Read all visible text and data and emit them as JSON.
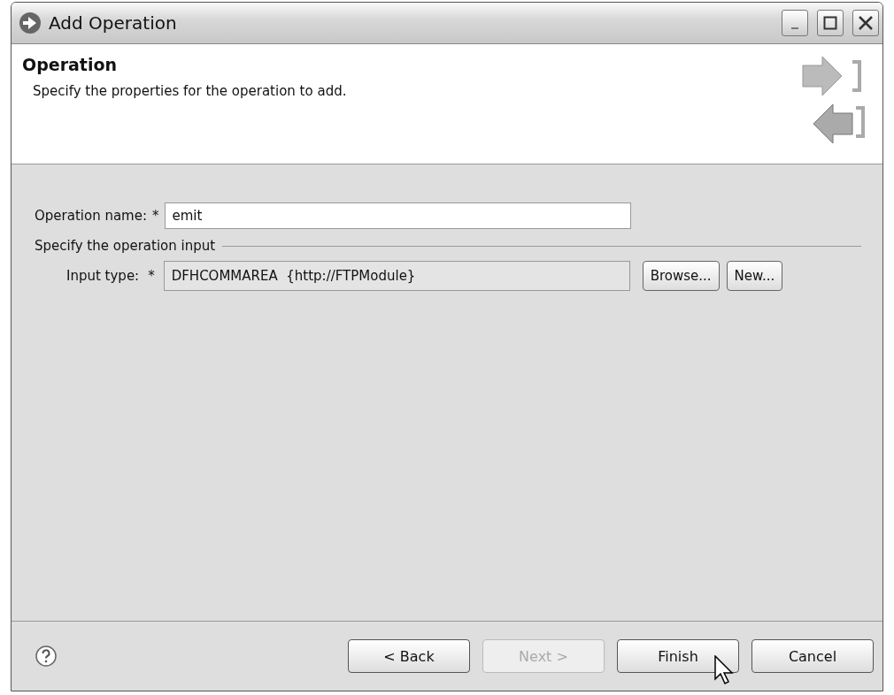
{
  "window": {
    "title": "Add Operation"
  },
  "header": {
    "title": "Operation",
    "description": "Specify the properties for the operation to add."
  },
  "form": {
    "name_label": "Operation name:",
    "name_required": "*",
    "name_value": "emit",
    "group_label": "Specify the operation input",
    "type_label": "Input type:",
    "type_required": "*",
    "type_value": "DFHCOMMAREA  {http://FTPModule}",
    "type_buttons": [
      {
        "label": "Browse..."
      },
      {
        "label": "New..."
      }
    ]
  },
  "buttons": [
    {
      "label": "< Back",
      "disabled": false
    },
    {
      "label": "Next >",
      "disabled": true
    },
    {
      "label": "Finish",
      "disabled": false
    },
    {
      "label": "Cancel",
      "disabled": false
    }
  ]
}
